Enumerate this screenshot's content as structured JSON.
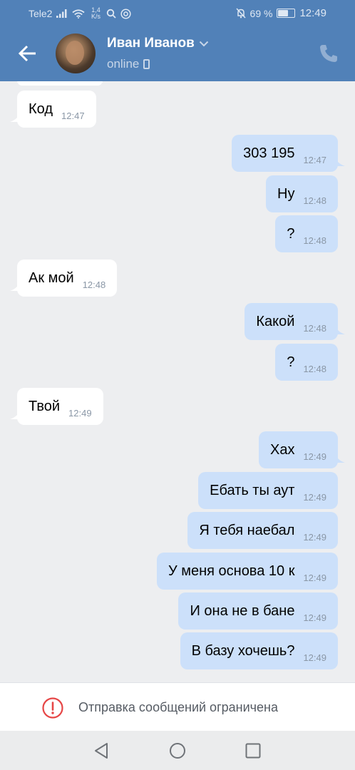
{
  "status_bar": {
    "carrier": "Tele2",
    "net_speed_value": "1,4",
    "net_speed_unit": "K/s",
    "battery": "69 %",
    "battery_level": 0.69,
    "time": "12:49"
  },
  "header": {
    "contact_name": "Иван Иванов",
    "status": "online"
  },
  "messages": [
    {
      "dir": "in",
      "text": "Код",
      "time": "12:47"
    },
    {
      "dir": "out",
      "text": "303 195",
      "time": "12:47"
    },
    {
      "dir": "out",
      "text": "Ну",
      "time": "12:48"
    },
    {
      "dir": "out",
      "text": "?",
      "time": "12:48"
    },
    {
      "dir": "in",
      "text": "Ак мой",
      "time": "12:48"
    },
    {
      "dir": "out",
      "text": "Какой",
      "time": "12:48"
    },
    {
      "dir": "out",
      "text": "?",
      "time": "12:48"
    },
    {
      "dir": "in",
      "text": "Твой",
      "time": "12:49"
    },
    {
      "dir": "out",
      "text": "Хах",
      "time": "12:49"
    },
    {
      "dir": "out",
      "text": "Ебать ты аут",
      "time": "12:49"
    },
    {
      "dir": "out",
      "text": "Я тебя наебал",
      "time": "12:49"
    },
    {
      "dir": "out",
      "text": "У меня основа 10 к",
      "time": "12:49"
    },
    {
      "dir": "out",
      "text": "И она не в бане",
      "time": "12:49"
    },
    {
      "dir": "out",
      "text": "В базу хочешь?",
      "time": "12:49"
    }
  ],
  "restriction": {
    "text": "Отправка сообщений ограничена"
  },
  "icons": {
    "back": "arrow-left-icon",
    "call": "phone-icon",
    "warning": "exclamation-circle-icon",
    "nav_back": "triangle-back-icon",
    "nav_home": "circle-home-icon",
    "nav_recents": "square-recents-icon"
  },
  "colors": {
    "header": "#5181b8",
    "background": "#edeef0",
    "incoming_bubble": "#ffffff",
    "outgoing_bubble": "#cce0fa",
    "warning": "#e64646"
  }
}
